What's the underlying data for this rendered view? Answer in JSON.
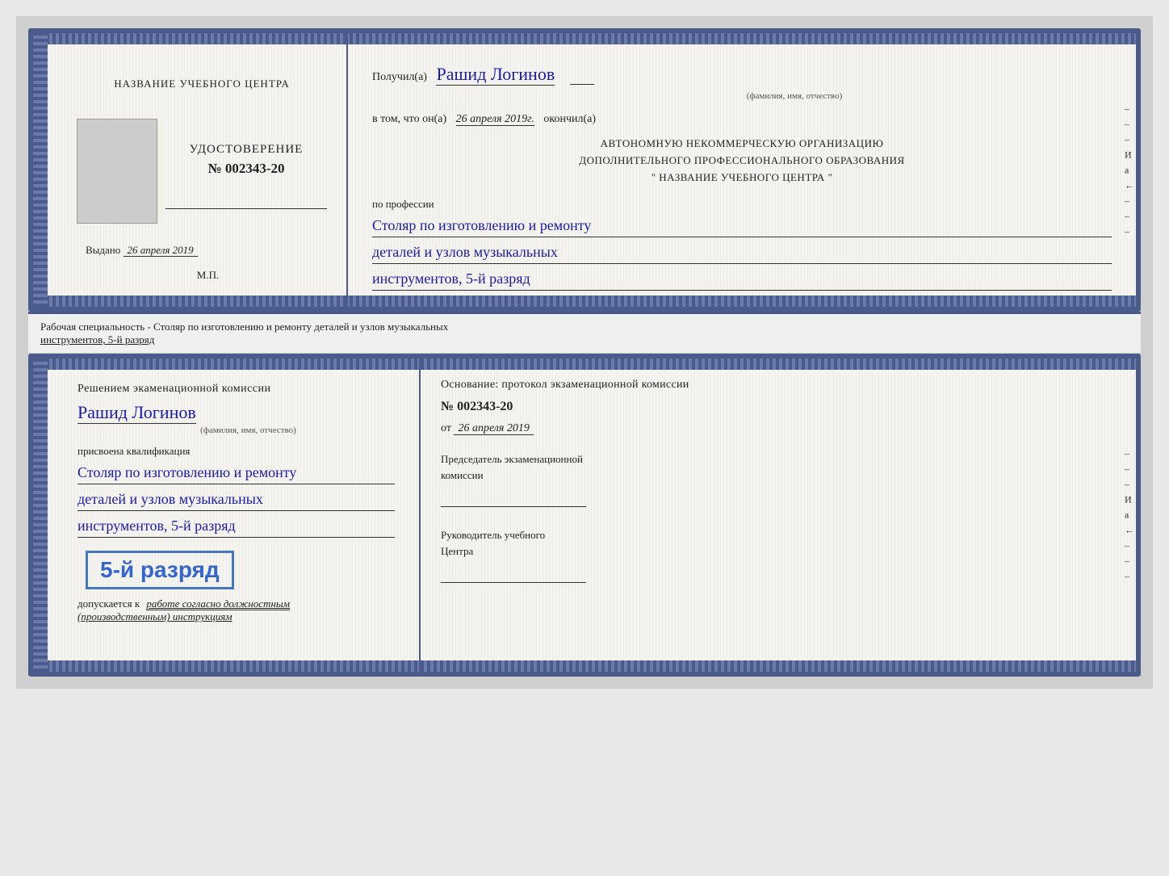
{
  "page": {
    "background_color": "#d0d0d0"
  },
  "doc1": {
    "left": {
      "center_name": "НАЗВАНИЕ УЧЕБНОГО ЦЕНТРА",
      "udostoverenie": "УДОСТОВЕРЕНИЕ",
      "number_label": "№",
      "number_value": "002343-20",
      "issued_label": "Выдано",
      "issued_date": "26 апреля 2019",
      "mp_label": "М.П."
    },
    "right": {
      "received_label": "Получил(а)",
      "recipient_name": "Рашид Логинов",
      "fio_label": "(фамилия, имя, отчество)",
      "vtom_label": "в том, что он(а)",
      "vtom_date": "26 апреля 2019г.",
      "okonchil": "окончил(а)",
      "org_line1": "АВТОНОМНУЮ НЕКОММЕРЧЕСКУЮ ОРГАНИЗАЦИЮ",
      "org_line2": "ДОПОЛНИТЕЛЬНОГО ПРОФЕССИОНАЛЬНОГО ОБРАЗОВАНИЯ",
      "org_line3": "\" НАЗВАНИЕ УЧЕБНОГО ЦЕНТРА \"",
      "profession_label": "по профессии",
      "profession_line1": "Столяр по изготовлению и ремонту",
      "profession_line2": "деталей и узлов музыкальных",
      "profession_line3": "инструментов, 5-й разряд"
    }
  },
  "specialty_text": "Рабочая специальность - Столяр по изготовлению и ремонту деталей и узлов музыкальных",
  "specialty_underline": "инструментов, 5-й разряд",
  "doc2": {
    "left": {
      "decision_text": "Решением экаменационной комиссии",
      "name": "Рашид Логинов",
      "fio_label": "(фамилия, имя, отчество)",
      "prisvoena": "присвоена квалификация",
      "qual_line1": "Столяр по изготовлению и ремонту",
      "qual_line2": "деталей и узлов музыкальных",
      "qual_line3": "инструментов, 5-й разряд",
      "grade_label": "5-й разряд",
      "допускается": "допускается к",
      "work_text": "работе согласно должностным",
      "instruktsii": "(производственным) инструкциям"
    },
    "right": {
      "osnование_label": "Основание: протокол экзаменационной комиссии",
      "number_label": "№",
      "number_value": "002343-20",
      "ot_label": "от",
      "ot_date": "26 апреля 2019",
      "chairman_line1": "Председатель экзаменационной",
      "chairman_line2": "комиссии",
      "rukovoditel_line1": "Руководитель учебного",
      "rukovoditel_line2": "Центра"
    }
  },
  "side_chars": {
    "top": [
      "И",
      "a",
      "←",
      "–",
      "–",
      "–",
      "–"
    ],
    "bottom": [
      "И",
      "a",
      "←",
      "–",
      "–",
      "–",
      "–"
    ]
  }
}
